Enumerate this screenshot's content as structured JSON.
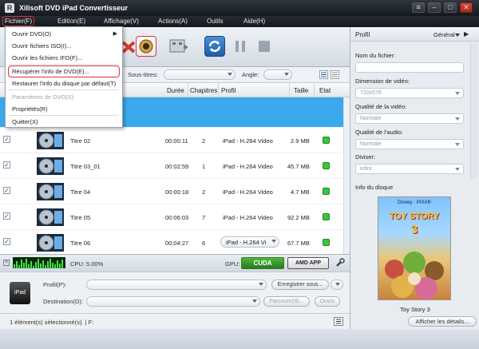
{
  "window": {
    "title": "Xilisoft DVD iPad Convertisseur",
    "logo": "R"
  },
  "menubar": [
    "Fichier(F)",
    "Edition(E)",
    "Affichage(V)",
    "Actions(A)",
    "Outils",
    "Aide(H)"
  ],
  "file_menu": {
    "items": [
      {
        "label": "Ouvrir DVD(O)",
        "has_submenu": true
      },
      {
        "label": "Ouvrir fichiers ISO(I)..."
      },
      {
        "label": "Ouvrir les fichiers IFO(F)..."
      },
      {
        "label": "Récupérer l'info de DVD(E)...",
        "highlighted": true
      },
      {
        "label": "Restaurer l'info du disque par défaut(T)"
      },
      {
        "label": "Paramètres de DVD(S)",
        "disabled": true
      },
      {
        "label": "Propriétés(R)"
      },
      {
        "label": "Quitter(X)"
      }
    ]
  },
  "filters": {
    "subtitles_label": "Sous-titres:",
    "angle_label": "Angle:"
  },
  "columns": {
    "duration": "Durée",
    "chapters": "Chapitres",
    "profile": "Profil",
    "size": "Taille",
    "state": "Etat"
  },
  "rows": [
    {
      "name": "",
      "duration": "",
      "chapters": "",
      "profile": "",
      "size": "",
      "highlighted": true
    },
    {
      "name": "Titre 02",
      "duration": "00:00:11",
      "chapters": "2",
      "profile": "iPad - H.264 Video",
      "size": "2.9 MB"
    },
    {
      "name": "Titre 03_01",
      "duration": "00:02:59",
      "chapters": "1",
      "profile": "iPad - H.264 Video",
      "size": "45.7 MB"
    },
    {
      "name": "Titre 04",
      "duration": "00:00:18",
      "chapters": "2",
      "profile": "iPad - H.264 Video",
      "size": "4.7 MB"
    },
    {
      "name": "Titre 05",
      "duration": "00:06:03",
      "chapters": "7",
      "profile": "iPad - H.264 Video",
      "size": "92.2 MB"
    },
    {
      "name": "Titre 06",
      "duration": "00:04:27",
      "chapters": "6",
      "profile": "iPad - H.264 Vi",
      "size": "67.7 MB",
      "profile_dropdown": true
    }
  ],
  "status": {
    "cpu": "CPU: 5.00%",
    "gpu": "GPU:",
    "cuda": "CUDA",
    "amd": "AMD APP"
  },
  "output": {
    "device": "iPad",
    "profile_label": "Profil(P):",
    "save_as": "Enregistrer sous...",
    "destination_label": "Destination(D):",
    "browse": "Parcourir(B)...",
    "open": "Ouvrir"
  },
  "statusbar": {
    "text": "1 élément(s) sélectionné(s). | F:"
  },
  "right_panel": {
    "title": "Profil",
    "mode": "Général",
    "file_name_label": "Nom du fichier:",
    "video_dim_label": "Dimension de vidéo:",
    "video_dim_value": "720x576",
    "video_quality_label": "Qualité de la vidéo:",
    "video_quality_value": "Normale",
    "audio_quality_label": "Qualité de l'audio:",
    "audio_quality_value": "Normale",
    "split_label": "Diviser:",
    "split_value": "infini",
    "disc_info_label": "Info du disque",
    "poster_brand": "Disney · PIXAR",
    "poster_title": "TOY STORY",
    "poster_number": "3",
    "poster_caption": "Toy Story 3",
    "details_button": "Afficher les détails..."
  }
}
